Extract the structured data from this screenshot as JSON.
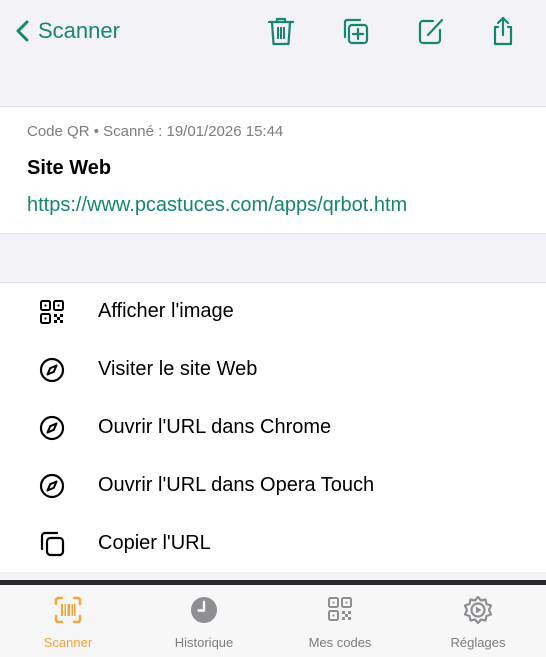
{
  "nav": {
    "back_label": "Scanner",
    "icons": [
      "trash-icon",
      "duplicate-icon",
      "edit-icon",
      "share-icon"
    ]
  },
  "info": {
    "meta": "Code QR • Scanné : 19/01/2026 15:44",
    "kind": "Site Web",
    "url": "https://www.pcastuces.com/apps/qrbot.htm"
  },
  "actions": [
    {
      "label": "Afficher l'image",
      "icon": "qr-code-icon"
    },
    {
      "label": "Visiter le site Web",
      "icon": "compass-icon"
    },
    {
      "label": "Ouvrir l'URL dans Chrome",
      "icon": "compass-icon"
    },
    {
      "label": "Ouvrir l'URL dans Opera Touch",
      "icon": "compass-icon"
    },
    {
      "label": "Copier l'URL",
      "icon": "copy-icon"
    }
  ],
  "tabs": [
    {
      "label": "Scanner",
      "icon": "barcode-scan-icon",
      "active": true
    },
    {
      "label": "Historique",
      "icon": "clock-icon",
      "active": false
    },
    {
      "label": "Mes codes",
      "icon": "qr-code-icon",
      "active": false
    },
    {
      "label": "Réglages",
      "icon": "settings-icon",
      "active": false
    }
  ],
  "colors": {
    "accent": "#16876f",
    "tab_active": "#f4a23b",
    "tab_inactive": "#7c7c82"
  }
}
